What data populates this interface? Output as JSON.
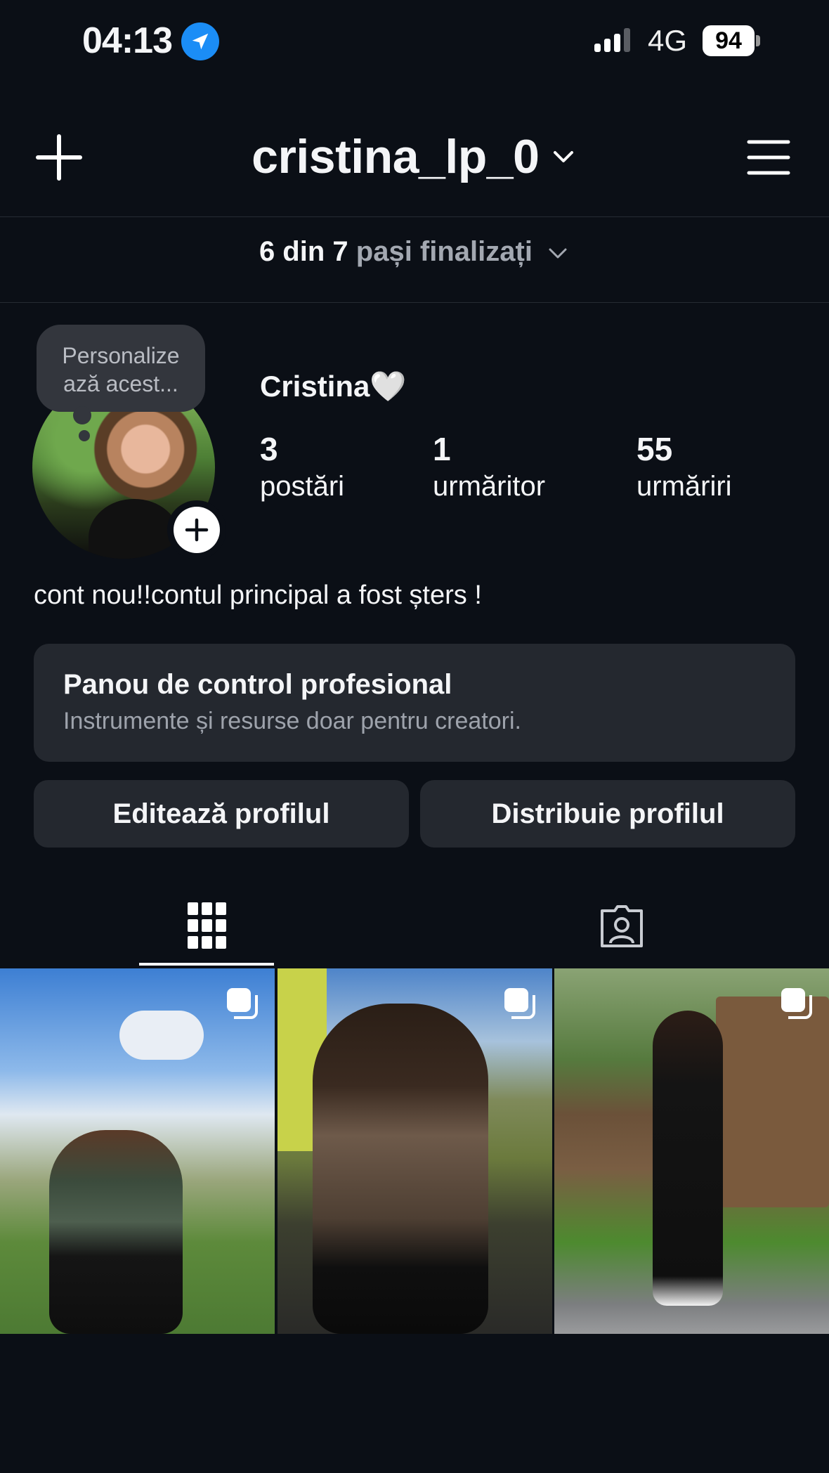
{
  "status_bar": {
    "time": "04:13",
    "network": "4G",
    "battery": "94"
  },
  "header": {
    "username": "cristina_lp_0",
    "steps_strong": "6 din 7",
    "steps_muted": "pași finalizați"
  },
  "profile": {
    "tooltip": "Personalizează acest...",
    "tooltip_line1": "Personalize",
    "tooltip_line2": "ază acest...",
    "display_name": "Cristina🤍",
    "stats": {
      "posts_count": "3",
      "posts_label": "postări",
      "followers_count": "1",
      "followers_label": "urmăritor",
      "following_count": "55",
      "following_label": "urmăriri"
    },
    "bio": "cont nou!!contul principal a fost șters !"
  },
  "dashboard": {
    "title": "Panou de control profesional",
    "subtitle": "Instrumente și resurse doar pentru creatori."
  },
  "actions": {
    "edit_label": "Editează profilul",
    "share_label": "Distribuie profilul"
  },
  "tabs": [
    "grid-icon",
    "tagged-icon"
  ],
  "colors": {
    "background": "#0b0f16",
    "card": "#24282f",
    "accent_blue": "#1b8df6",
    "text": "#f4f5f7",
    "muted": "#a3a8b1"
  }
}
